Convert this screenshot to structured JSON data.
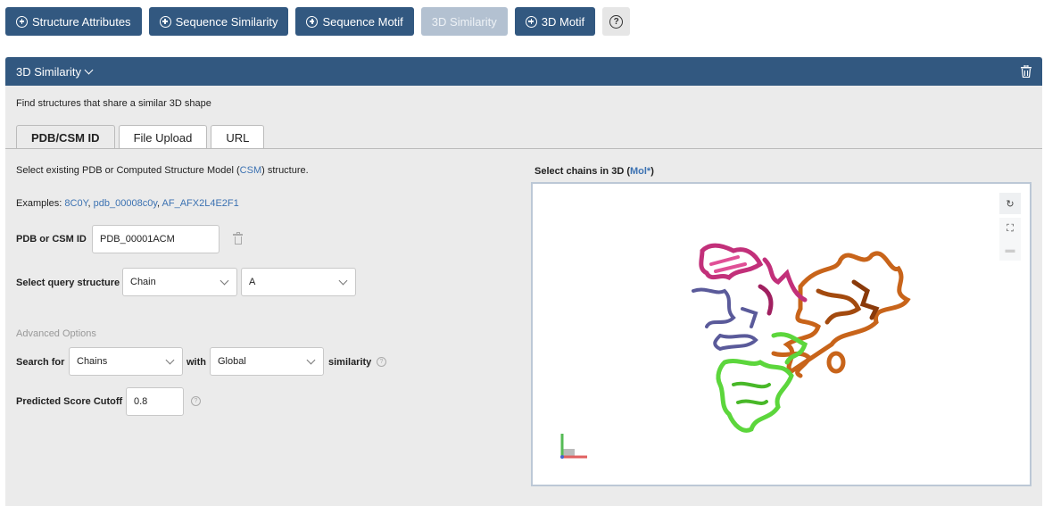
{
  "toolbar": {
    "buttons": [
      {
        "label": "Structure Attributes"
      },
      {
        "label": "Sequence Similarity"
      },
      {
        "label": "Sequence Motif"
      },
      {
        "label": "3D Similarity"
      },
      {
        "label": "3D Motif"
      }
    ],
    "help_label": "?"
  },
  "panel": {
    "title": "3D Similarity",
    "description": "Find structures that share a similar 3D shape",
    "tabs": [
      {
        "label": "PDB/CSM ID"
      },
      {
        "label": "File Upload"
      },
      {
        "label": "URL"
      }
    ]
  },
  "form": {
    "intro_prefix": "Select existing PDB or Computed Structure Model (",
    "intro_link": "CSM",
    "intro_suffix": ") structure.",
    "examples_label": "Examples:",
    "examples": [
      "8C0Y",
      "pdb_00008c0y",
      "AF_AFX2L4E2F1"
    ],
    "id_label": "PDB or CSM ID",
    "id_value": "PDB_00001ACM",
    "query_label": "Select query structure",
    "query_type": "Chain",
    "query_chain": "A",
    "advanced_label": "Advanced Options",
    "search_for_label": "Search for",
    "search_for_value": "Chains",
    "with_label": "with",
    "with_value": "Global",
    "similarity_label": "similarity",
    "cutoff_label": "Predicted Score Cutoff",
    "cutoff_value": "0.8"
  },
  "viewer": {
    "label_prefix": "Select chains in 3D (",
    "label_link": "Mol*",
    "label_suffix": ")",
    "chain_colors": [
      "#c2307a",
      "#5a5a9a",
      "#c8641a",
      "#5cd63c"
    ]
  }
}
